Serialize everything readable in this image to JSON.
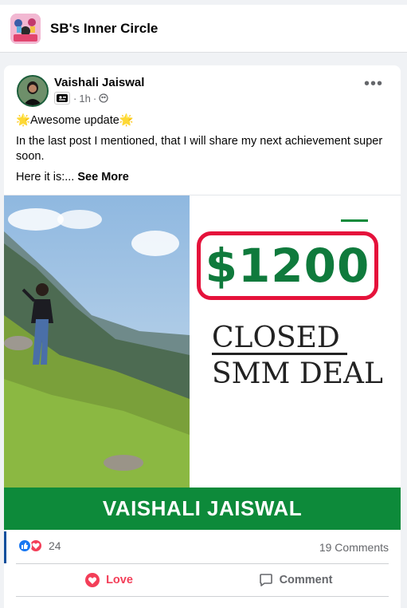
{
  "group": {
    "title": "SB's Inner Circle"
  },
  "post": {
    "author": "Vaishali Jaiswal",
    "time": "1h",
    "separator": "·",
    "line1": "🌟Awesome update🌟",
    "line2": "In the last post I mentioned, that  I will share my next achievement super soon.",
    "line3_prefix": "Here it is:...",
    "see_more": "See More",
    "more_icon": "more-dots-icon"
  },
  "media": {
    "amount": "$1200",
    "deal_line1": "CLOSED",
    "deal_line2": "SMM DEAL",
    "name_banner": "VAISHALI JAISWAL",
    "colors": {
      "green": "#0d8a3a",
      "amount_green": "#0f7a3c",
      "red_border": "#e5123b"
    }
  },
  "stats": {
    "reaction_count": "24",
    "comments": "19 Comments"
  },
  "actions": {
    "love_label": "Love",
    "comment_label": "Comment"
  }
}
